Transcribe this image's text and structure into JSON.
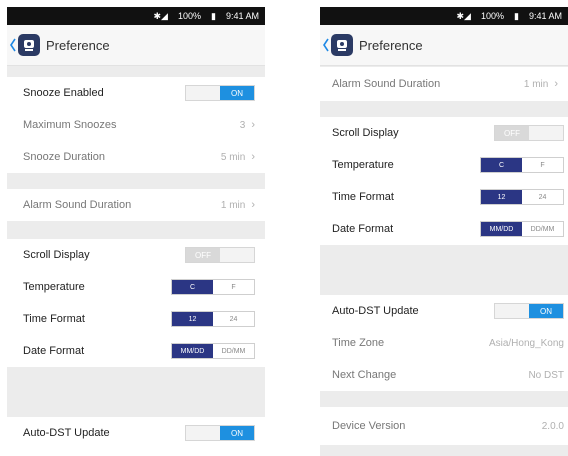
{
  "status": {
    "battery": "100%",
    "time": "9:41 AM"
  },
  "screenA": {
    "title": "Preference",
    "snooze_enabled": {
      "label": "Snooze Enabled",
      "on": "ON"
    },
    "max_snoozes": {
      "label": "Maximum Snoozes",
      "value": "3"
    },
    "snooze_duration": {
      "label": "Snooze Duration",
      "value": "5 min"
    },
    "alarm_duration": {
      "label": "Alarm Sound Duration",
      "value": "1 min"
    },
    "scroll_display": {
      "label": "Scroll Display",
      "off": "OFF"
    },
    "temperature": {
      "label": "Temperature",
      "opt1": "C",
      "opt2": "F"
    },
    "time_format": {
      "label": "Time Format",
      "opt1": "12",
      "opt2": "24"
    },
    "date_format": {
      "label": "Date Format",
      "opt1": "MM/DD",
      "opt2": "DD/MM"
    },
    "auto_dst": {
      "label": "Auto-DST Update",
      "on": "ON"
    }
  },
  "screenB": {
    "title": "Preference",
    "alarm_duration": {
      "label": "Alarm Sound Duration",
      "value": "1 min"
    },
    "scroll_display": {
      "label": "Scroll Display",
      "off": "OFF"
    },
    "temperature": {
      "label": "Temperature",
      "opt1": "C",
      "opt2": "F"
    },
    "time_format": {
      "label": "Time Format",
      "opt1": "12",
      "opt2": "24"
    },
    "date_format": {
      "label": "Date Format",
      "opt1": "MM/DD",
      "opt2": "DD/MM"
    },
    "auto_dst": {
      "label": "Auto-DST Update",
      "on": "ON"
    },
    "time_zone": {
      "label": "Time Zone",
      "value": "Asia/Hong_Kong"
    },
    "next_change": {
      "label": "Next Change",
      "value": "No DST"
    },
    "device_version": {
      "label": "Device Version",
      "value": "2.0.0"
    }
  },
  "colors": {
    "accent_on": "#1e90e0",
    "segment_selected": "#2b3684",
    "logo": "#2b3a64"
  },
  "icons": [
    "bluetooth-icon",
    "signal-icon",
    "battery-icon",
    "back-chevron-icon",
    "app-logo-icon",
    "chevron-right-icon"
  ]
}
